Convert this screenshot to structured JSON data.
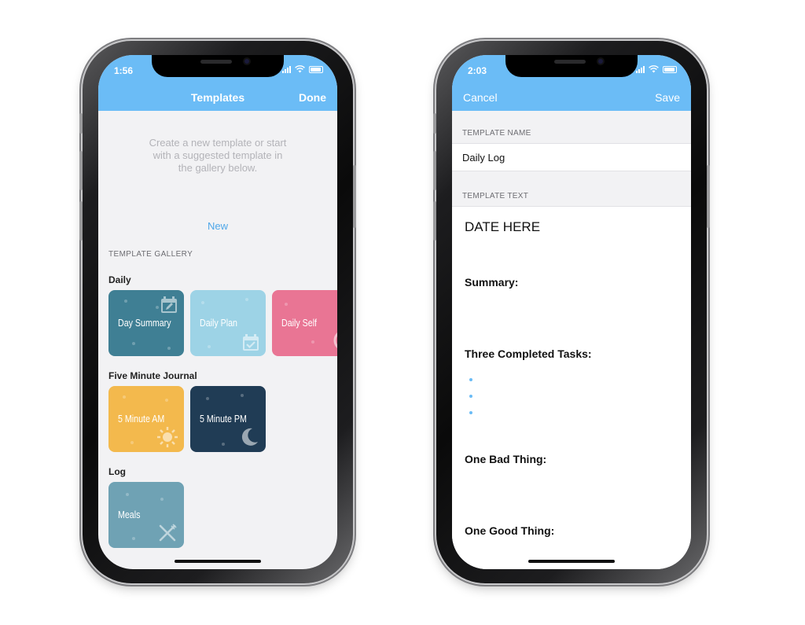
{
  "left_screen": {
    "status_time": "1:56",
    "nav": {
      "title": "Templates",
      "done_label": "Done"
    },
    "intro_text": "Create a new template or start with a suggested template in the gallery below.",
    "new_label": "New",
    "gallery_label": "TEMPLATE GALLERY",
    "sections": [
      {
        "title": "Daily",
        "cards": [
          {
            "name": "Day Summary",
            "color": "#3f7f94",
            "icon": "calendar-edit-icon"
          },
          {
            "name": "Daily Plan",
            "color": "#9dd3e6",
            "icon": "calendar-check-icon"
          },
          {
            "name": "Daily Self",
            "color": "#e97594",
            "icon": "smile-icon"
          }
        ]
      },
      {
        "title": "Five Minute Journal",
        "cards": [
          {
            "name": "5 Minute AM",
            "color": "#f3b94d",
            "icon": "sun-icon"
          },
          {
            "name": "5 Minute PM",
            "color": "#203c55",
            "icon": "moon-icon"
          }
        ]
      },
      {
        "title": "Log",
        "cards": [
          {
            "name": "Meals",
            "color": "#6fa2b4",
            "icon": "fork-knife-icon"
          }
        ]
      }
    ]
  },
  "right_screen": {
    "status_time": "2:03",
    "nav": {
      "cancel_label": "Cancel",
      "save_label": "Save"
    },
    "template_name_label": "TEMPLATE NAME",
    "template_name_value": "Daily Log",
    "template_text_label": "TEMPLATE TEXT",
    "template_text": {
      "date": "DATE HERE",
      "summary": "Summary:",
      "tasks": "Three Completed Tasks:",
      "bad": "One Bad Thing:",
      "good": "One Good Thing:"
    }
  },
  "colors": {
    "accent": "#6bbcf6",
    "link": "#4fa7e8"
  }
}
